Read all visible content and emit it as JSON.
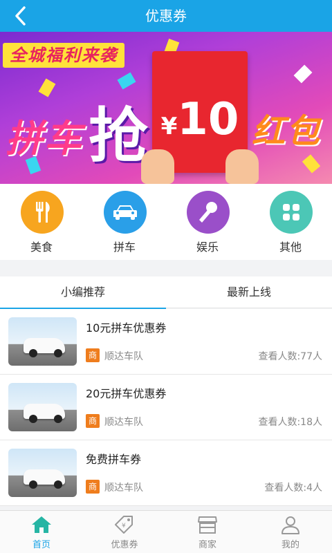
{
  "header": {
    "title": "优惠券"
  },
  "banner": {
    "slogan": "全城福利来袭",
    "text_pin": "拼车",
    "text_qiang": "抢",
    "currency": "¥",
    "amount": "10",
    "text_hongbao": "红包"
  },
  "categories": [
    {
      "label": "美食",
      "icon": "fork-knife-icon",
      "color": "#f7a51f"
    },
    {
      "label": "拼车",
      "icon": "car-icon",
      "color": "#2a9fe8"
    },
    {
      "label": "娱乐",
      "icon": "microphone-icon",
      "color": "#9a4fc9"
    },
    {
      "label": "其他",
      "icon": "grid-icon",
      "color": "#4cc7b6"
    }
  ],
  "tabs": [
    {
      "label": "小编推荐",
      "active": true
    },
    {
      "label": "最新上线",
      "active": false
    }
  ],
  "items": [
    {
      "name": "10元拼车优惠券",
      "badge": "商",
      "merchant": "顺达车队",
      "views": "查看人数:77人"
    },
    {
      "name": "20元拼车优惠券",
      "badge": "商",
      "merchant": "顺达车队",
      "views": "查看人数:18人"
    },
    {
      "name": "免费拼车券",
      "badge": "商",
      "merchant": "顺达车队",
      "views": "查看人数:4人"
    }
  ],
  "nav": [
    {
      "label": "首页",
      "icon": "home-icon",
      "active": true
    },
    {
      "label": "优惠券",
      "icon": "coupon-tag-icon",
      "active": false
    },
    {
      "label": "商家",
      "icon": "store-icon",
      "active": false
    },
    {
      "label": "我的",
      "icon": "user-icon",
      "active": false
    }
  ],
  "colors": {
    "primary": "#1aa4e6",
    "badge": "#ef7d1d",
    "red_envelope": "#e8262f"
  }
}
